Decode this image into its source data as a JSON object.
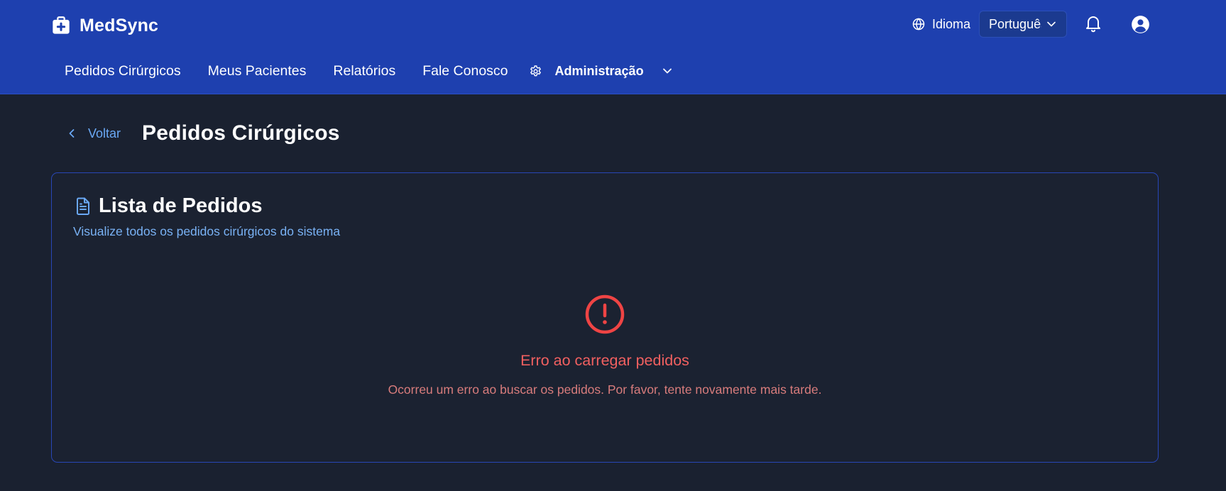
{
  "header": {
    "brand_name": "MedSync",
    "language_label": "Idioma",
    "language_value": "Português",
    "nav": [
      {
        "label": "Pedidos Cirúrgicos"
      },
      {
        "label": "Meus Pacientes"
      },
      {
        "label": "Relatórios"
      },
      {
        "label": "Fale Conosco"
      }
    ],
    "admin_label": "Administração",
    "icons": [
      "medical-bag-icon",
      "globe-icon",
      "chevron-down-icon",
      "bell-icon",
      "user-circle-icon",
      "gear-icon"
    ]
  },
  "page": {
    "back_label": "Voltar",
    "title": "Pedidos Cirúrgicos"
  },
  "card": {
    "title": "Lista de Pedidos",
    "subtitle": "Visualize todos os pedidos cirúrgicos do sistema",
    "error_title": "Erro ao carregar pedidos",
    "error_message": "Ocorreu um erro ao buscar os pedidos. Por favor, tente novamente mais tarde."
  },
  "colors": {
    "header_bg": "#1e40af",
    "page_bg": "#1a2130",
    "accent_link": "#6aa8f5",
    "error": "#ef4444"
  }
}
